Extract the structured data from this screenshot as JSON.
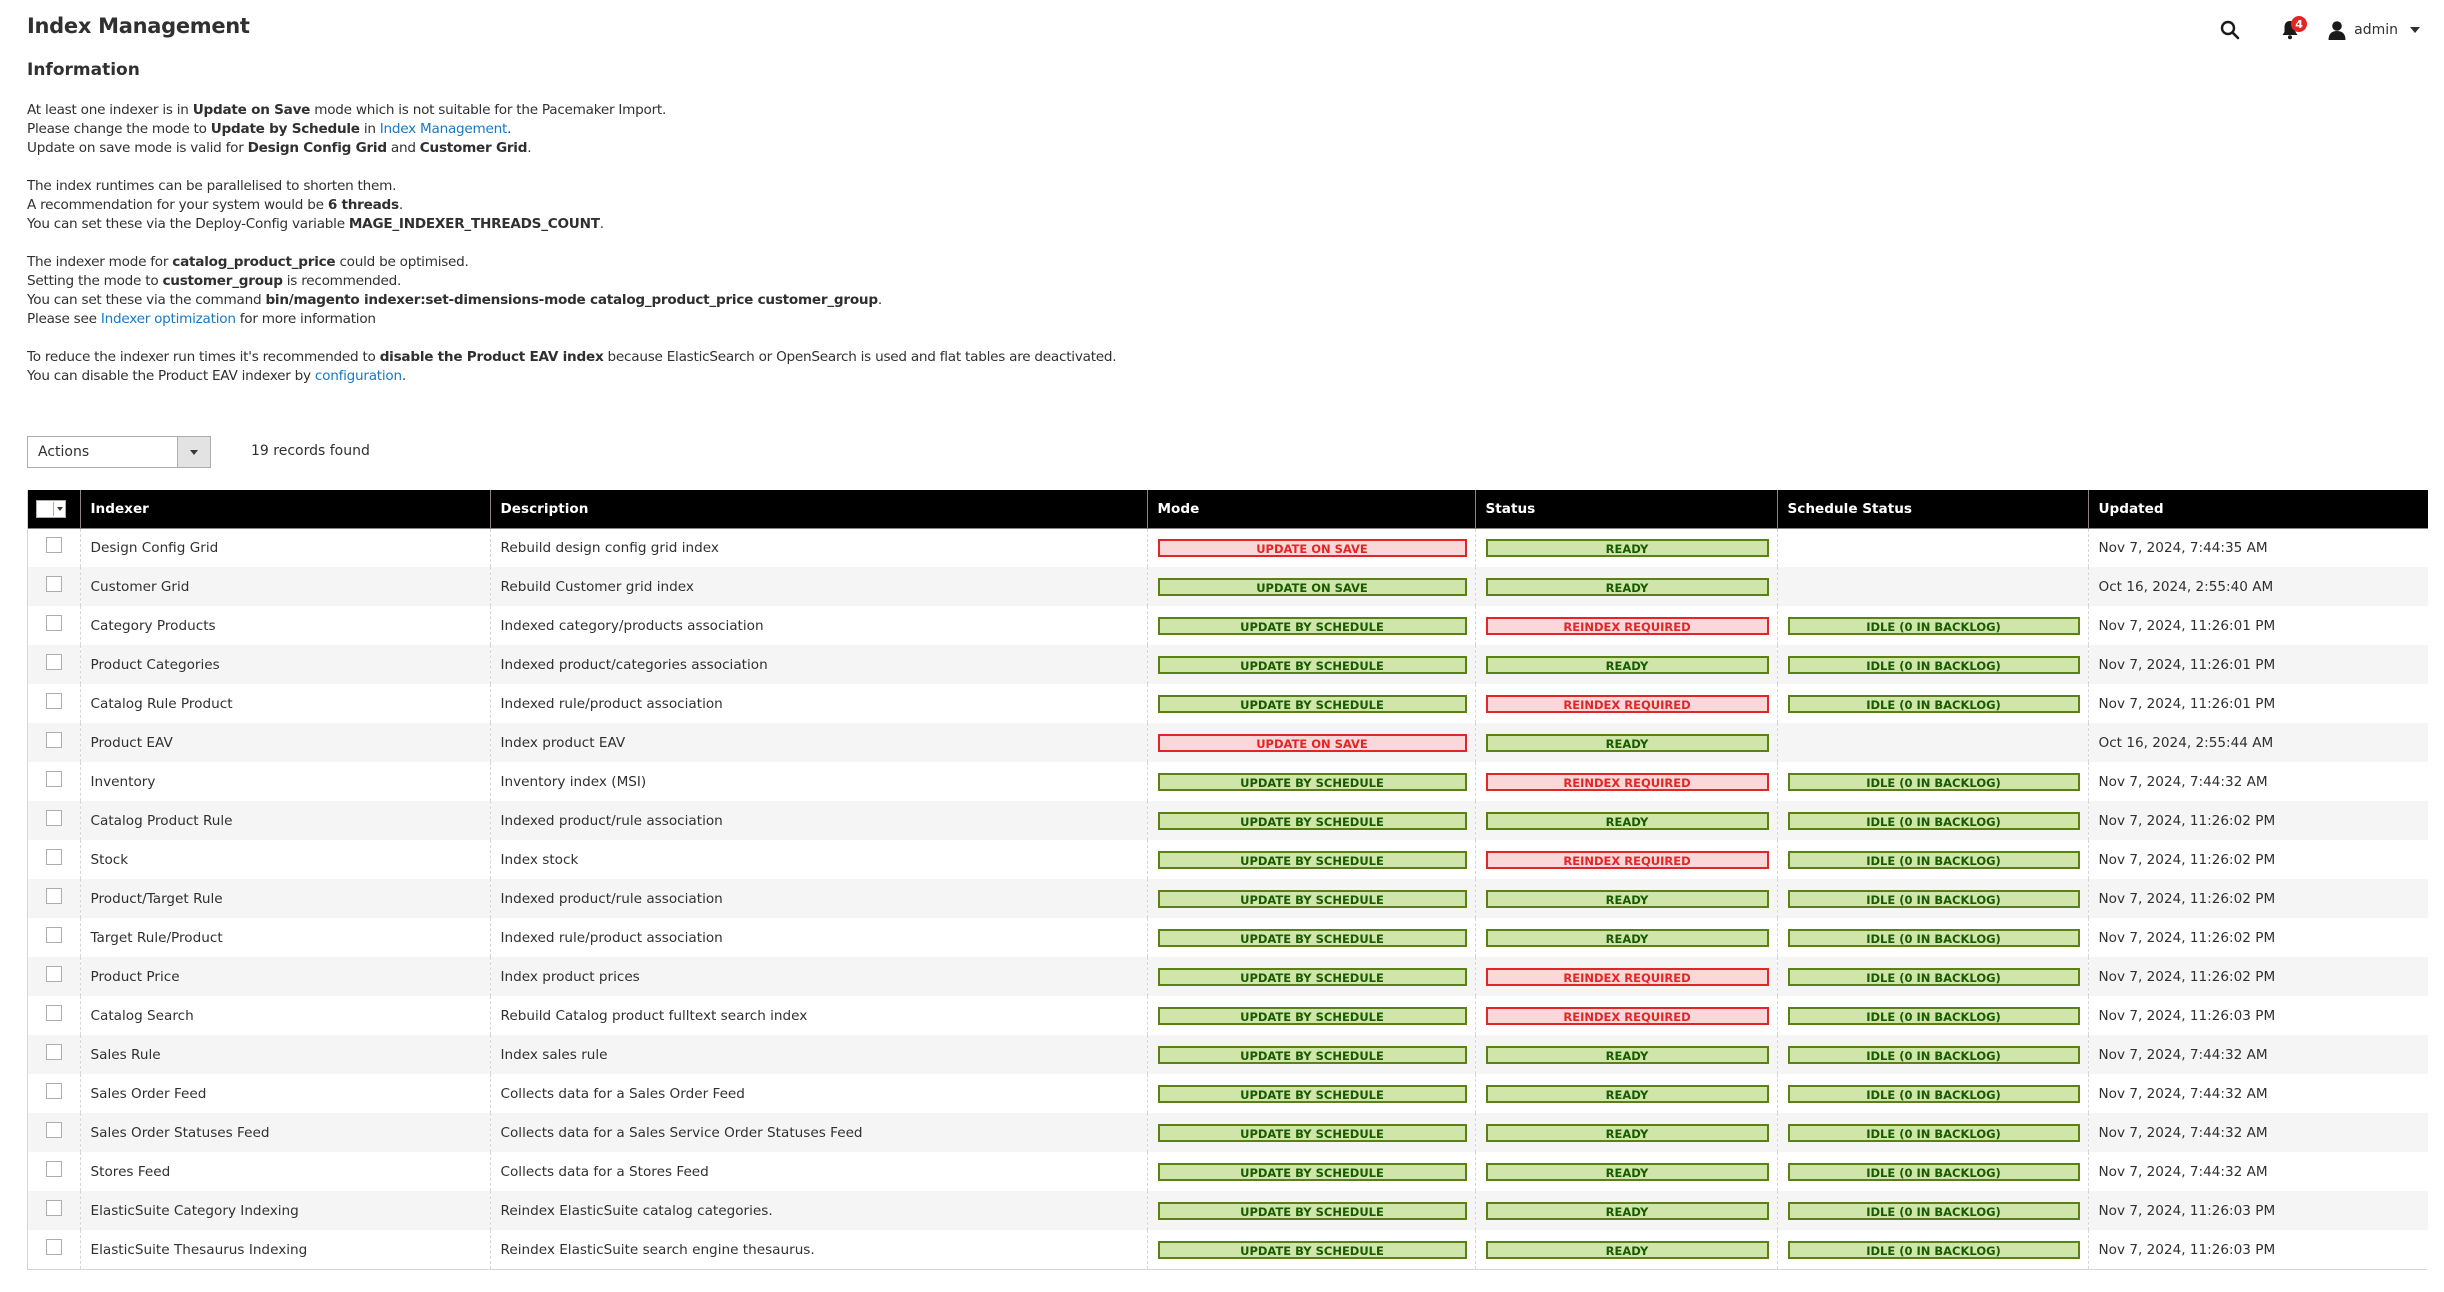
{
  "header": {
    "title": "Index Management",
    "notifications_count": "4",
    "user_name": "admin",
    "icons": {
      "search": "search-icon",
      "notifications": "bell-icon",
      "user": "user-icon",
      "user_menu": "chevron-down-icon"
    }
  },
  "information": {
    "title": "Information",
    "block1": {
      "line1": {
        "pre": "At least one indexer is in ",
        "bold": "Update on Save",
        "post": " mode which is not suitable for the Pacemaker Import."
      },
      "line2": {
        "pre": "Please change the mode to ",
        "bold": "Update by Schedule",
        "mid": " in ",
        "link": "Index Management",
        "post": "."
      },
      "line3": {
        "pre": "Update on save mode is valid for ",
        "bold1": "Design Config Grid",
        "mid": " and ",
        "bold2": "Customer Grid",
        "post": "."
      }
    },
    "block2": {
      "line1": "The index runtimes can be parallelised to shorten them.",
      "line2": {
        "pre": "A recommendation for your system would be ",
        "bold": "6 threads",
        "post": "."
      },
      "line3": {
        "pre": "You can set these via the Deploy-Config variable ",
        "bold": "MAGE_INDEXER_THREADS_COUNT",
        "post": "."
      }
    },
    "block3": {
      "line1": {
        "pre": "The indexer mode for ",
        "bold": "catalog_product_price",
        "post": " could be optimised."
      },
      "line2": {
        "pre": "Setting the mode to ",
        "bold": "customer_group",
        "post": " is recommended."
      },
      "line3": {
        "pre": "You can set these via the command ",
        "bold": "bin/magento indexer:set-dimensions-mode catalog_product_price customer_group",
        "post": "."
      },
      "line4": {
        "pre": "Please see ",
        "link": "Indexer optimization",
        "post": " for more information"
      }
    },
    "block4": {
      "line1": {
        "pre": "To reduce the indexer run times it's recommended to ",
        "bold": "disable the Product EAV index",
        "post": " because ElasticSearch or OpenSearch is used and flat tables are deactivated."
      },
      "line2": {
        "pre": "You can disable the Product EAV indexer by ",
        "link": "configuration",
        "post": "."
      }
    }
  },
  "toolbar": {
    "actions_label": "Actions",
    "records_found": "19 records found"
  },
  "grid": {
    "columns": [
      "Indexer",
      "Description",
      "Mode",
      "Status",
      "Schedule Status",
      "Updated"
    ],
    "rows": [
      {
        "indexer": "Design Config Grid",
        "description": "Rebuild design config grid index",
        "mode": "UPDATE ON SAVE",
        "mode_state": "err",
        "status": "READY",
        "status_state": "ok",
        "schedule": "",
        "updated": "Nov 7, 2024, 7:44:35 AM"
      },
      {
        "indexer": "Customer Grid",
        "description": "Rebuild Customer grid index",
        "mode": "UPDATE ON SAVE",
        "mode_state": "ok",
        "status": "READY",
        "status_state": "ok",
        "schedule": "",
        "updated": "Oct 16, 2024, 2:55:40 AM"
      },
      {
        "indexer": "Category Products",
        "description": "Indexed category/products association",
        "mode": "UPDATE BY SCHEDULE",
        "mode_state": "ok",
        "status": "REINDEX REQUIRED",
        "status_state": "err",
        "schedule": "IDLE (0 IN BACKLOG)",
        "updated": "Nov 7, 2024, 11:26:01 PM"
      },
      {
        "indexer": "Product Categories",
        "description": "Indexed product/categories association",
        "mode": "UPDATE BY SCHEDULE",
        "mode_state": "ok",
        "status": "READY",
        "status_state": "ok",
        "schedule": "IDLE (0 IN BACKLOG)",
        "updated": "Nov 7, 2024, 11:26:01 PM"
      },
      {
        "indexer": "Catalog Rule Product",
        "description": "Indexed rule/product association",
        "mode": "UPDATE BY SCHEDULE",
        "mode_state": "ok",
        "status": "REINDEX REQUIRED",
        "status_state": "err",
        "schedule": "IDLE (0 IN BACKLOG)",
        "updated": "Nov 7, 2024, 11:26:01 PM"
      },
      {
        "indexer": "Product EAV",
        "description": "Index product EAV",
        "mode": "UPDATE ON SAVE",
        "mode_state": "err",
        "status": "READY",
        "status_state": "ok",
        "schedule": "",
        "updated": "Oct 16, 2024, 2:55:44 AM"
      },
      {
        "indexer": "Inventory",
        "description": "Inventory index (MSI)",
        "mode": "UPDATE BY SCHEDULE",
        "mode_state": "ok",
        "status": "REINDEX REQUIRED",
        "status_state": "err",
        "schedule": "IDLE (0 IN BACKLOG)",
        "updated": "Nov 7, 2024, 7:44:32 AM"
      },
      {
        "indexer": "Catalog Product Rule",
        "description": "Indexed product/rule association",
        "mode": "UPDATE BY SCHEDULE",
        "mode_state": "ok",
        "status": "READY",
        "status_state": "ok",
        "schedule": "IDLE (0 IN BACKLOG)",
        "updated": "Nov 7, 2024, 11:26:02 PM"
      },
      {
        "indexer": "Stock",
        "description": "Index stock",
        "mode": "UPDATE BY SCHEDULE",
        "mode_state": "ok",
        "status": "REINDEX REQUIRED",
        "status_state": "err",
        "schedule": "IDLE (0 IN BACKLOG)",
        "updated": "Nov 7, 2024, 11:26:02 PM"
      },
      {
        "indexer": "Product/Target Rule",
        "description": "Indexed product/rule association",
        "mode": "UPDATE BY SCHEDULE",
        "mode_state": "ok",
        "status": "READY",
        "status_state": "ok",
        "schedule": "IDLE (0 IN BACKLOG)",
        "updated": "Nov 7, 2024, 11:26:02 PM"
      },
      {
        "indexer": "Target Rule/Product",
        "description": "Indexed rule/product association",
        "mode": "UPDATE BY SCHEDULE",
        "mode_state": "ok",
        "status": "READY",
        "status_state": "ok",
        "schedule": "IDLE (0 IN BACKLOG)",
        "updated": "Nov 7, 2024, 11:26:02 PM"
      },
      {
        "indexer": "Product Price",
        "description": "Index product prices",
        "mode": "UPDATE BY SCHEDULE",
        "mode_state": "ok",
        "status": "REINDEX REQUIRED",
        "status_state": "err",
        "schedule": "IDLE (0 IN BACKLOG)",
        "updated": "Nov 7, 2024, 11:26:02 PM"
      },
      {
        "indexer": "Catalog Search",
        "description": "Rebuild Catalog product fulltext search index",
        "mode": "UPDATE BY SCHEDULE",
        "mode_state": "ok",
        "status": "REINDEX REQUIRED",
        "status_state": "err",
        "schedule": "IDLE (0 IN BACKLOG)",
        "updated": "Nov 7, 2024, 11:26:03 PM"
      },
      {
        "indexer": "Sales Rule",
        "description": "Index sales rule",
        "mode": "UPDATE BY SCHEDULE",
        "mode_state": "ok",
        "status": "READY",
        "status_state": "ok",
        "schedule": "IDLE (0 IN BACKLOG)",
        "updated": "Nov 7, 2024, 7:44:32 AM"
      },
      {
        "indexer": "Sales Order Feed",
        "description": "Collects data for a Sales Order Feed",
        "mode": "UPDATE BY SCHEDULE",
        "mode_state": "ok",
        "status": "READY",
        "status_state": "ok",
        "schedule": "IDLE (0 IN BACKLOG)",
        "updated": "Nov 7, 2024, 7:44:32 AM"
      },
      {
        "indexer": "Sales Order Statuses Feed",
        "description": "Collects data for a Sales Service Order Statuses Feed",
        "mode": "UPDATE BY SCHEDULE",
        "mode_state": "ok",
        "status": "READY",
        "status_state": "ok",
        "schedule": "IDLE (0 IN BACKLOG)",
        "updated": "Nov 7, 2024, 7:44:32 AM"
      },
      {
        "indexer": "Stores Feed",
        "description": "Collects data for a Stores Feed",
        "mode": "UPDATE BY SCHEDULE",
        "mode_state": "ok",
        "status": "READY",
        "status_state": "ok",
        "schedule": "IDLE (0 IN BACKLOG)",
        "updated": "Nov 7, 2024, 7:44:32 AM"
      },
      {
        "indexer": "ElasticSuite Category Indexing",
        "description": "Reindex ElasticSuite catalog categories.",
        "mode": "UPDATE BY SCHEDULE",
        "mode_state": "ok",
        "status": "READY",
        "status_state": "ok",
        "schedule": "IDLE (0 IN BACKLOG)",
        "updated": "Nov 7, 2024, 11:26:03 PM"
      },
      {
        "indexer": "ElasticSuite Thesaurus Indexing",
        "description": "Reindex ElasticSuite search engine thesaurus.",
        "mode": "UPDATE BY SCHEDULE",
        "mode_state": "ok",
        "status": "READY",
        "status_state": "ok",
        "schedule": "IDLE (0 IN BACKLOG)",
        "updated": "Nov 7, 2024, 11:26:03 PM"
      }
    ]
  },
  "colors": {
    "ok_bg": "#d0e5a9",
    "ok_border": "#5b8116",
    "ok_text": "#185b00",
    "err_bg": "#fad7d8",
    "err_border": "#e22626",
    "err_text": "#e22626",
    "link": "#1979c3",
    "header_bg": "#000000",
    "badge": "#e22626"
  }
}
